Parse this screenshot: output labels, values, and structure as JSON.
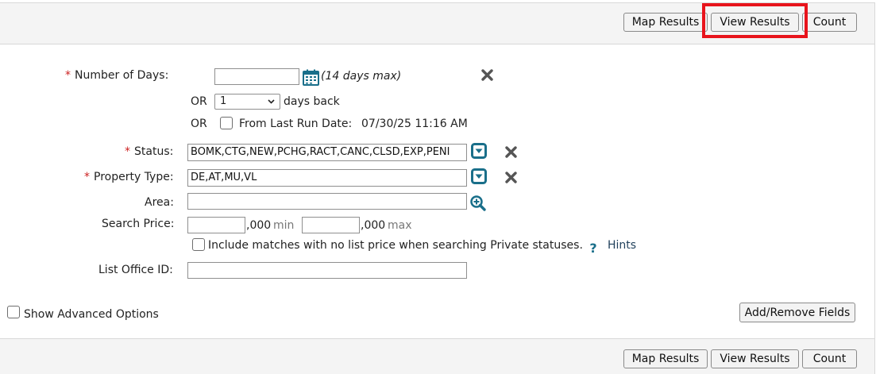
{
  "toolbar": {
    "map_results": "Map Results",
    "view_results": "View Results",
    "count": "Count"
  },
  "form": {
    "number_of_days": {
      "label": "Number of Days:",
      "value": "",
      "hint": "(14 days max)"
    },
    "days_back": {
      "or": "OR",
      "selected": "1",
      "suffix": "days back"
    },
    "last_run": {
      "or": "OR",
      "label": "From Last Run Date:",
      "date": "07/30/25 11:16 AM",
      "checked": false
    },
    "status": {
      "label": "Status:",
      "value": "BOMK,CTG,NEW,PCHG,RACT,CANC,CLSD,EXP,PENI"
    },
    "property_type": {
      "label": "Property Type:",
      "value": "DE,AT,MU,VL"
    },
    "area": {
      "label": "Area:",
      "value": ""
    },
    "search_price": {
      "label": "Search Price:",
      "min_value": "",
      "min_suffix": ",000",
      "min_word": "min",
      "max_value": "",
      "max_suffix": ",000",
      "max_word": "max"
    },
    "no_list_price": {
      "label": "Include matches with no list price when searching Private statuses.",
      "checked": false
    },
    "hints": "Hints",
    "list_office_id": {
      "label": "List Office ID:",
      "value": ""
    }
  },
  "advanced": {
    "label": "Show Advanced Options",
    "checked": false
  },
  "add_remove_fields": "Add/Remove Fields",
  "colors": {
    "required": "#cc1f1f",
    "icon_teal": "#1a6f8a",
    "highlight": "#e8141c"
  }
}
